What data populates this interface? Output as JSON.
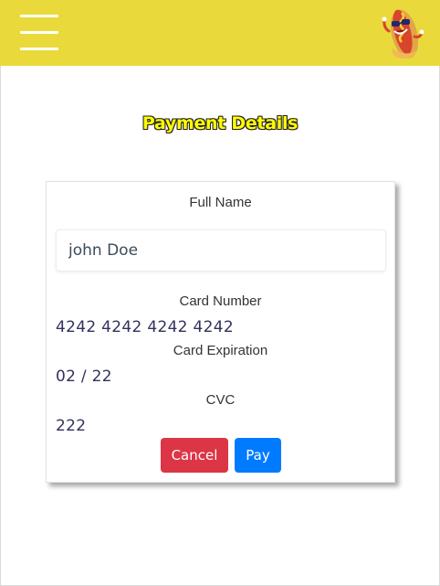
{
  "header": {
    "menu_icon": "hamburger-menu-icon",
    "logo_icon": "hotdog-mascot-logo",
    "background_color": "#ead93a"
  },
  "page": {
    "title": "Payment Details"
  },
  "form": {
    "full_name_label": "Full Name",
    "full_name_value": "john Doe",
    "card_number_label": "Card Number",
    "card_number_value": "4242 4242 4242 4242",
    "card_expiration_label": "Card Expiration",
    "card_expiration_value": "02 / 22",
    "cvc_label": "CVC",
    "cvc_value": "222",
    "cancel_label": "Cancel",
    "pay_label": "Pay",
    "cancel_color": "#dc3545",
    "pay_color": "#007bff"
  }
}
